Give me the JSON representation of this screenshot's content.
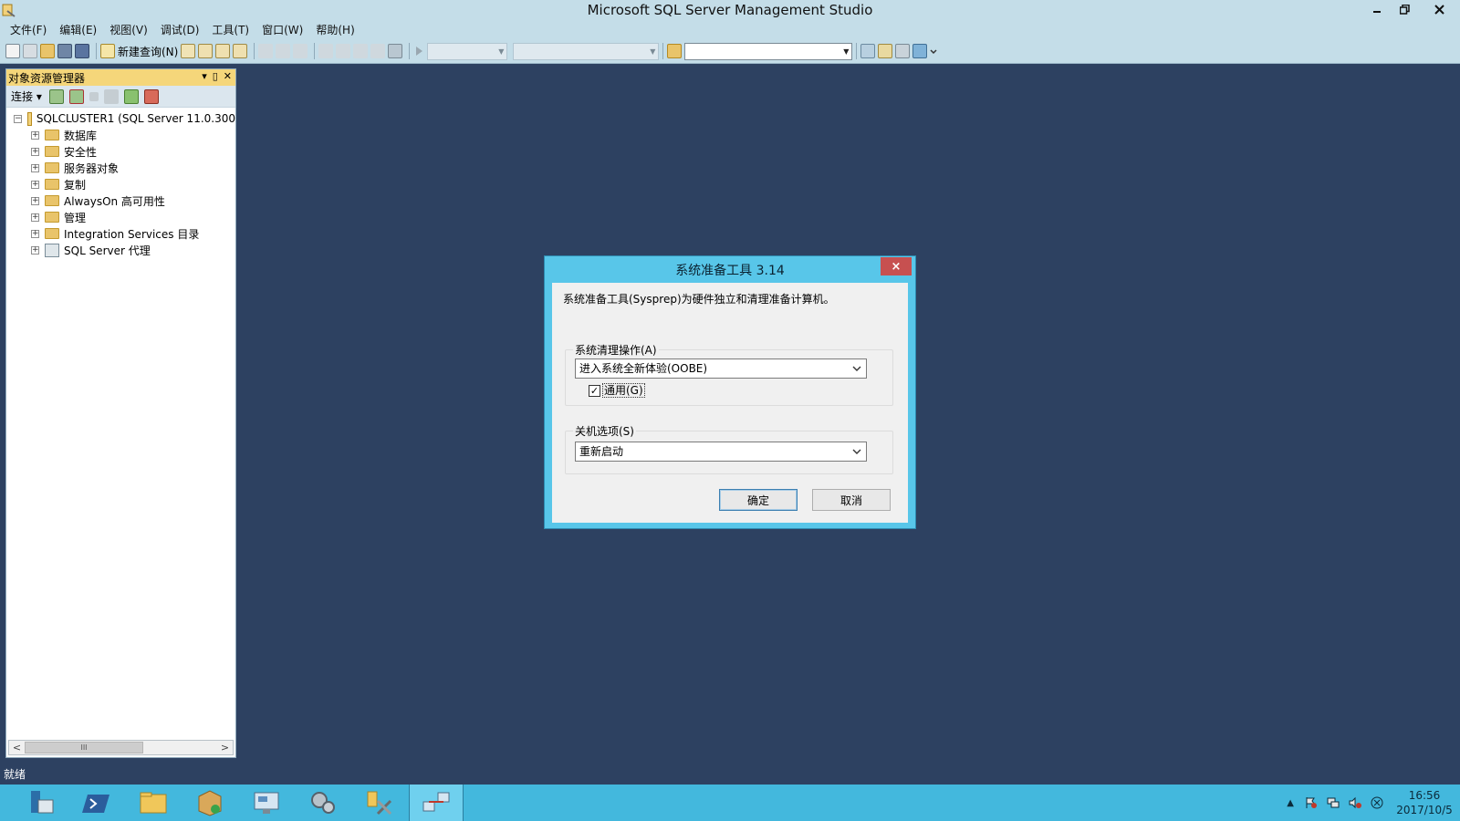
{
  "window": {
    "title": "Microsoft SQL Server Management Studio",
    "min_icon": "minimize-icon",
    "max_icon": "restore-icon",
    "close_icon": "close-icon"
  },
  "menu": [
    "文件(F)",
    "编辑(E)",
    "视图(V)",
    "调试(D)",
    "工具(T)",
    "窗口(W)",
    "帮助(H)"
  ],
  "toolbar": {
    "new_query_label": "新建查询(N)"
  },
  "object_explorer": {
    "title": "对象资源管理器",
    "connect_label": "连接",
    "root": "SQLCLUSTER1 (SQL Server 11.0.300",
    "items": [
      {
        "label": "数据库",
        "icon": "folder-icon"
      },
      {
        "label": "安全性",
        "icon": "folder-icon"
      },
      {
        "label": "服务器对象",
        "icon": "folder-icon"
      },
      {
        "label": "复制",
        "icon": "folder-icon"
      },
      {
        "label": "AlwaysOn 高可用性",
        "icon": "folder-icon"
      },
      {
        "label": "管理",
        "icon": "folder-icon"
      },
      {
        "label": "Integration Services 目录",
        "icon": "folder-icon"
      },
      {
        "label": "SQL Server 代理",
        "icon": "agent-icon"
      }
    ],
    "scroll_thumb": "III"
  },
  "status": {
    "text": "就绪"
  },
  "dialog": {
    "title": "系统准备工具 3.14",
    "close_label": "×",
    "description": "系统准备工具(Sysprep)为硬件独立和清理准备计算机。",
    "cleanup": {
      "label": "系统清理操作(A)",
      "value": "进入系统全新体验(OOBE)",
      "generalize_label": "通用(G)",
      "generalize_checked": true
    },
    "shutdown": {
      "label": "关机选项(S)",
      "value": "重新启动"
    },
    "ok_label": "确定",
    "cancel_label": "取消"
  },
  "taskbar": {
    "apps": [
      "server-manager-icon",
      "powershell-icon",
      "file-explorer-icon",
      "package-icon",
      "remote-desktop-icon",
      "services-icon",
      "tools-icon",
      "network-icon"
    ],
    "time": "16:56",
    "date": "2017/10/5"
  },
  "colors": {
    "desktop": "#2d4161",
    "chrome": "#c4dde8",
    "dialog_frame": "#58c6e9",
    "close_red": "#c75050",
    "taskbar": "#43b8dd"
  }
}
